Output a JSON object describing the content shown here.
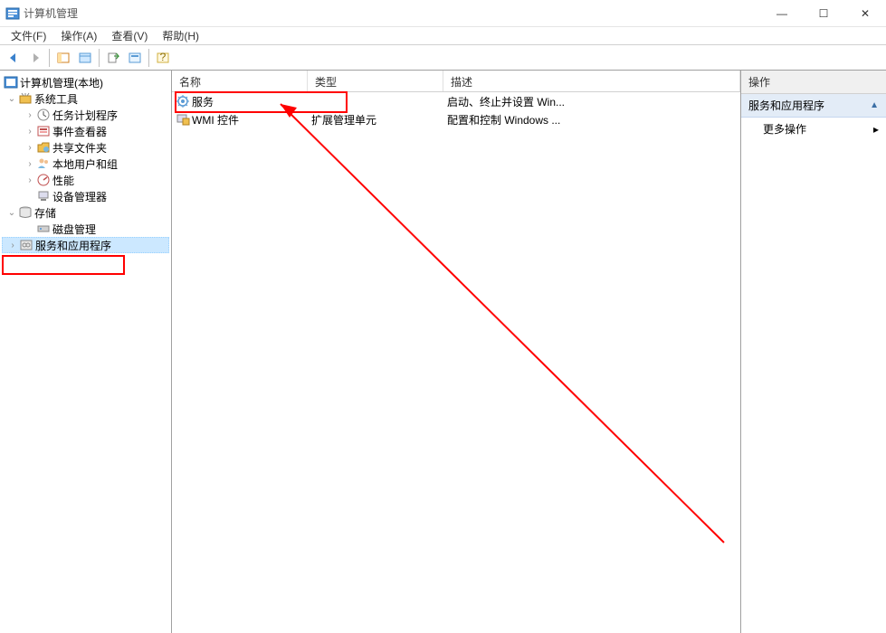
{
  "window": {
    "title": "计算机管理",
    "minimize": "—",
    "maximize": "☐",
    "close": "✕"
  },
  "menu": {
    "file": "文件(F)",
    "action": "操作(A)",
    "view": "查看(V)",
    "help": "帮助(H)"
  },
  "tree": {
    "root": "计算机管理(本地)",
    "system_tools": "系统工具",
    "task_scheduler": "任务计划程序",
    "event_viewer": "事件查看器",
    "shared_folders": "共享文件夹",
    "local_users": "本地用户和组",
    "performance": "性能",
    "device_manager": "设备管理器",
    "storage": "存储",
    "disk_management": "磁盘管理",
    "services_apps": "服务和应用程序"
  },
  "list": {
    "headers": {
      "name": "名称",
      "type": "类型",
      "description": "描述"
    },
    "rows": [
      {
        "name": "服务",
        "type": "",
        "description": "启动、终止并设置 Win..."
      },
      {
        "name": "WMI 控件",
        "type": "扩展管理单元",
        "description": "配置和控制 Windows ..."
      }
    ]
  },
  "actions": {
    "header": "操作",
    "section": "服务和应用程序",
    "more_actions": "更多操作"
  }
}
